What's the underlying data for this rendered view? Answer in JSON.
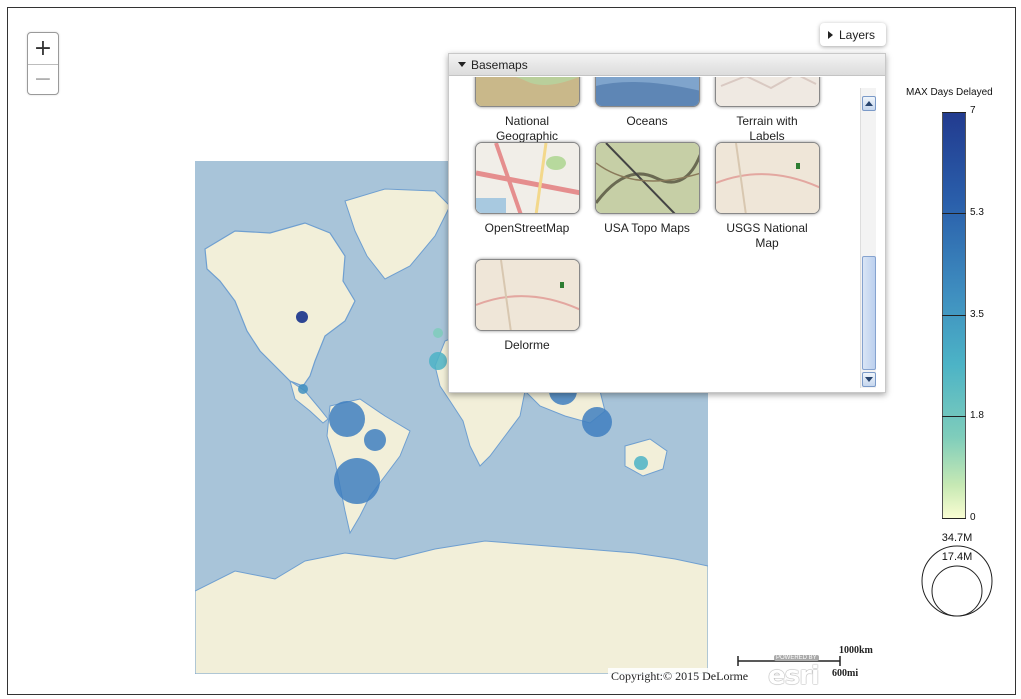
{
  "zoom": {
    "in_label": "+",
    "out_label": "−"
  },
  "layers_button": {
    "label": "Layers"
  },
  "basemaps": {
    "title": "Basemaps",
    "items": [
      {
        "label": "National\nGeographic",
        "thumb": "natgeo"
      },
      {
        "label": "Oceans",
        "thumb": "oceans"
      },
      {
        "label": "Terrain with\nLabels",
        "thumb": "terrain"
      },
      {
        "label": "OpenStreetMap",
        "thumb": "osm"
      },
      {
        "label": "USA Topo Maps",
        "thumb": "topo"
      },
      {
        "label": "USGS National\nMap",
        "thumb": "usgs"
      },
      {
        "label": "Delorme",
        "thumb": "delorme"
      }
    ]
  },
  "legend": {
    "title": "MAX Days Delayed",
    "ticks": [
      "7",
      "5.3",
      "3.5",
      "1.8",
      "0"
    ],
    "size_max": "34.7M",
    "size_mid": "17.4M"
  },
  "copyright": "Copyright:© 2015 DeLorme",
  "scale": {
    "km": "1000km",
    "mi": "600mi"
  },
  "esri": {
    "powered": "POWERED BY",
    "logo": "esri"
  },
  "colors": {
    "water": "#a8c4d9",
    "land": "#f2efd9",
    "accent": "#4a7fc1"
  }
}
